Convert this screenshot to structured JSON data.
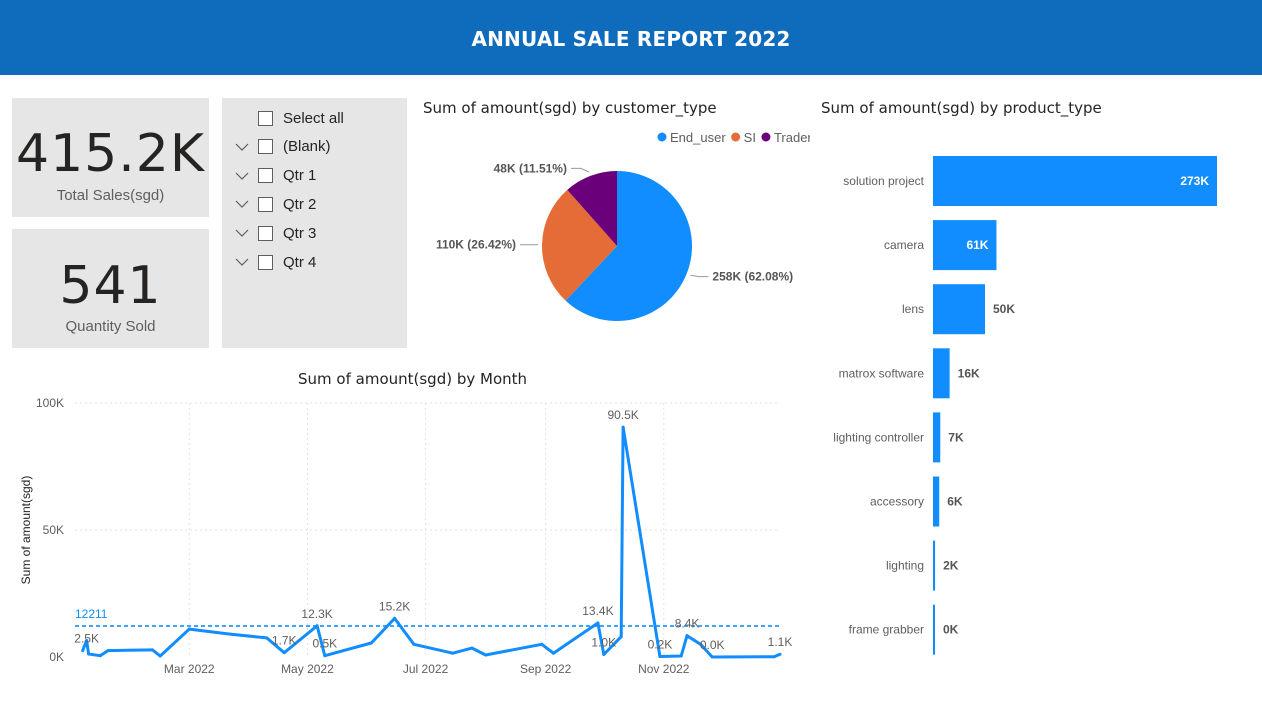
{
  "header": {
    "title": "ANNUAL SALE REPORT 2022"
  },
  "kpis": {
    "total_sales": {
      "value": "415.2K",
      "label": "Total Sales(sgd)"
    },
    "quantity": {
      "value": "541",
      "label": "Quantity Sold"
    }
  },
  "slicer": {
    "items": [
      {
        "label": "Select all",
        "expandable": false
      },
      {
        "label": "(Blank)",
        "expandable": true
      },
      {
        "label": "Qtr 1",
        "expandable": true
      },
      {
        "label": "Qtr 2",
        "expandable": true
      },
      {
        "label": "Qtr 3",
        "expandable": true
      },
      {
        "label": "Qtr 4",
        "expandable": true
      }
    ]
  },
  "colors": {
    "accent": "#118dff",
    "header": "#0f6cbd",
    "si": "#e66c37",
    "trader": "#6b007b",
    "card": "#e6e6e6"
  },
  "chart_data": [
    {
      "id": "pie",
      "type": "pie",
      "title": "Sum of amount(sgd) by customer_type",
      "legend_position": "top-right",
      "slices": [
        {
          "name": "End_user",
          "value": 258,
          "label": "258K (62.08%)",
          "color": "#118dff"
        },
        {
          "name": "SI",
          "value": 110,
          "label": "110K (26.42%)",
          "color": "#e66c37"
        },
        {
          "name": "Trader",
          "value": 48,
          "label": "48K (11.51%)",
          "color": "#6b007b"
        }
      ]
    },
    {
      "id": "bar",
      "type": "bar",
      "orientation": "horizontal",
      "title": "Sum of amount(sgd) by product_type",
      "categories": [
        "solution project",
        "camera",
        "lens",
        "matrox software",
        "lighting controller",
        "accessory",
        "lighting",
        "frame grabber"
      ],
      "values": [
        273,
        61,
        50,
        16,
        7,
        6,
        2,
        0
      ],
      "labels": [
        "273K",
        "61K",
        "50K",
        "16K",
        "7K",
        "6K",
        "2K",
        "0K"
      ],
      "color": "#118dff"
    },
    {
      "id": "line",
      "type": "line",
      "title": "Sum of amount(sgd) by Month",
      "ylabel": "Sum of amount(sgd)",
      "ylim": [
        0,
        100000
      ],
      "y_ticks": [
        0,
        50000,
        100000
      ],
      "y_tick_labels": [
        "0K",
        "50K",
        "100K"
      ],
      "x_ticks": [
        "2022-03-01",
        "2022-05-01",
        "2022-07-01",
        "2022-09-01",
        "2022-11-01"
      ],
      "x_tick_labels": [
        "Mar 2022",
        "May 2022",
        "Jul 2022",
        "Sep 2022",
        "Nov 2022"
      ],
      "grid": true,
      "average_line": {
        "value": 12211,
        "label": "12211"
      },
      "points": [
        {
          "date": "2022-01-05",
          "value": 2500
        },
        {
          "date": "2022-01-07",
          "value": 6500
        },
        {
          "date": "2022-01-08",
          "value": 1200
        },
        {
          "date": "2022-01-14",
          "value": 500
        },
        {
          "date": "2022-01-18",
          "value": 2500
        },
        {
          "date": "2022-02-10",
          "value": 2800
        },
        {
          "date": "2022-02-14",
          "value": 400
        },
        {
          "date": "2022-03-01",
          "value": 11000
        },
        {
          "date": "2022-03-22",
          "value": 9000
        },
        {
          "date": "2022-04-10",
          "value": 7500
        },
        {
          "date": "2022-04-19",
          "value": 1700
        },
        {
          "date": "2022-05-06",
          "value": 12300
        },
        {
          "date": "2022-05-10",
          "value": 500
        },
        {
          "date": "2022-06-03",
          "value": 5500
        },
        {
          "date": "2022-06-15",
          "value": 15200
        },
        {
          "date": "2022-06-25",
          "value": 5000
        },
        {
          "date": "2022-07-15",
          "value": 1500
        },
        {
          "date": "2022-07-25",
          "value": 3500
        },
        {
          "date": "2022-08-01",
          "value": 800
        },
        {
          "date": "2022-08-30",
          "value": 5000
        },
        {
          "date": "2022-09-05",
          "value": 1500
        },
        {
          "date": "2022-09-28",
          "value": 13400
        },
        {
          "date": "2022-10-01",
          "value": 1000
        },
        {
          "date": "2022-10-10",
          "value": 8000
        },
        {
          "date": "2022-10-11",
          "value": 90500
        },
        {
          "date": "2022-10-30",
          "value": 200
        },
        {
          "date": "2022-11-10",
          "value": 400
        },
        {
          "date": "2022-11-13",
          "value": 8400
        },
        {
          "date": "2022-11-20",
          "value": 5000
        },
        {
          "date": "2022-11-26",
          "value": 0
        },
        {
          "date": "2022-12-28",
          "value": 100
        },
        {
          "date": "2022-12-31",
          "value": 1100
        }
      ],
      "data_labels": [
        {
          "date": "2022-01-07",
          "value": 2500,
          "text": "2.5K"
        },
        {
          "date": "2022-04-19",
          "value": 1700,
          "text": "1.7K"
        },
        {
          "date": "2022-05-06",
          "value": 12300,
          "text": "12.3K"
        },
        {
          "date": "2022-05-10",
          "value": 500,
          "text": "0.5K"
        },
        {
          "date": "2022-06-15",
          "value": 15200,
          "text": "15.2K"
        },
        {
          "date": "2022-09-28",
          "value": 13400,
          "text": "13.4K"
        },
        {
          "date": "2022-10-01",
          "value": 1000,
          "text": "1.0K"
        },
        {
          "date": "2022-10-11",
          "value": 90500,
          "text": "90.5K"
        },
        {
          "date": "2022-10-30",
          "value": 200,
          "text": "0.2K"
        },
        {
          "date": "2022-11-13",
          "value": 8400,
          "text": "8.4K"
        },
        {
          "date": "2022-11-26",
          "value": 0,
          "text": "0.0K"
        },
        {
          "date": "2022-12-31",
          "value": 1100,
          "text": "1.1K"
        }
      ]
    }
  ]
}
